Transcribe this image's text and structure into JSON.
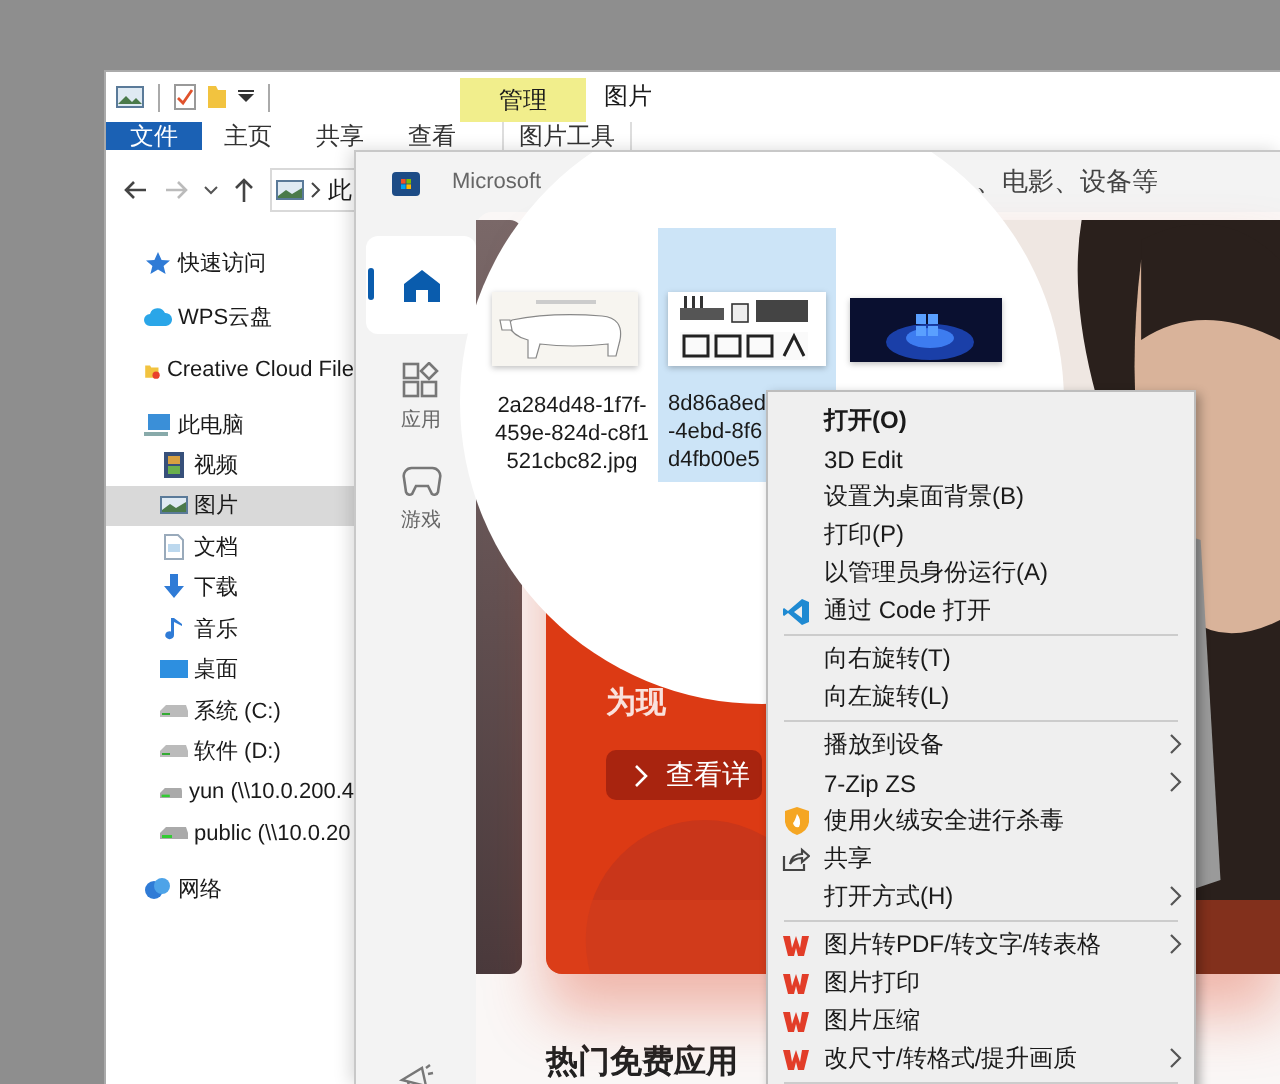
{
  "explorer": {
    "context_tab": "管理",
    "title": "图片",
    "ribbon_tabs": [
      {
        "label": "文件",
        "kind": "file"
      },
      {
        "label": "主页",
        "kind": "tab"
      },
      {
        "label": "共享",
        "kind": "tab"
      },
      {
        "label": "查看",
        "kind": "tab"
      },
      {
        "label": "图片工具",
        "kind": "context"
      }
    ],
    "breadcrumb": "此",
    "nav": [
      {
        "label": "快速访问",
        "selected": false
      },
      {
        "label": "WPS云盘",
        "selected": false
      },
      {
        "label": "Creative Cloud File",
        "selected": false
      },
      {
        "label": "此电脑",
        "selected": false,
        "children": [
          {
            "label": "视频",
            "selected": false
          },
          {
            "label": "图片",
            "selected": true
          },
          {
            "label": "文档",
            "selected": false
          },
          {
            "label": "下载",
            "selected": false
          },
          {
            "label": "音乐",
            "selected": false
          },
          {
            "label": "桌面",
            "selected": false
          },
          {
            "label": "系统 (C:)",
            "selected": false
          },
          {
            "label": "软件 (D:)",
            "selected": false
          },
          {
            "label": "yun (\\\\10.0.200.4",
            "selected": false
          },
          {
            "label": "public (\\\\10.0.20",
            "selected": false
          }
        ]
      },
      {
        "label": "网络",
        "selected": false
      }
    ],
    "files": [
      {
        "name_lines": [
          "2a284d48-1f7f-",
          "459e-824d-c8f1",
          "521cbc82.jpg"
        ],
        "selected": false
      },
      {
        "name_lines": [
          "8d86a8ed",
          "-4ebd-8f6",
          "d4fb00e5"
        ],
        "selected": true
      },
      {
        "selected": false
      }
    ]
  },
  "store": {
    "title": "Microsoft",
    "placeholder": "、电影、设备等",
    "nav": [
      {
        "selected": true
      },
      {
        "label": "应用",
        "selected": false
      },
      {
        "label": "游戏",
        "selected": false
      }
    ],
    "hero": {
      "text": "为现",
      "button": "查看详"
    },
    "section_title": "热门免费应用"
  },
  "context_menu": [
    {
      "kind": "default",
      "label": "打开(O)",
      "submenu": false
    },
    {
      "kind": "plain",
      "label": "3D Edit",
      "submenu": false
    },
    {
      "kind": "plain",
      "label": "设置为桌面背景(B)",
      "submenu": false
    },
    {
      "kind": "plain",
      "label": "打印(P)",
      "submenu": false
    },
    {
      "kind": "plain",
      "label": "以管理员身份运行(A)",
      "submenu": false
    },
    {
      "kind": "code",
      "label": "通过 Code 打开",
      "submenu": false
    },
    {
      "kind": "separator"
    },
    {
      "kind": "plain",
      "label": "向右旋转(T)",
      "submenu": false
    },
    {
      "kind": "plain",
      "label": "向左旋转(L)",
      "submenu": false
    },
    {
      "kind": "separator"
    },
    {
      "kind": "plain",
      "label": "播放到设备",
      "submenu": true
    },
    {
      "kind": "plain",
      "label": "7-Zip ZS",
      "submenu": true
    },
    {
      "kind": "antivirus",
      "label": "使用火绒安全进行杀毒",
      "submenu": false
    },
    {
      "kind": "share",
      "label": "共享",
      "submenu": false
    },
    {
      "kind": "plain",
      "label": "打开方式(H)",
      "submenu": true
    },
    {
      "kind": "separator"
    },
    {
      "kind": "wps",
      "label": "图片转PDF/转文字/转表格",
      "submenu": true
    },
    {
      "kind": "wps",
      "label": "图片打印",
      "submenu": false
    },
    {
      "kind": "wps",
      "label": "图片压缩",
      "submenu": false
    },
    {
      "kind": "wps",
      "label": "改尺寸/转格式/提升画质",
      "submenu": true
    },
    {
      "kind": "separator"
    }
  ]
}
